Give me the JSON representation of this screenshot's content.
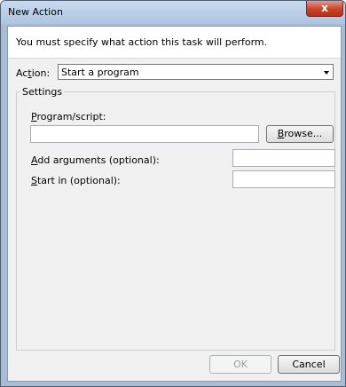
{
  "window": {
    "title": "New Action",
    "close_label": "x"
  },
  "header": {
    "text": "You must specify what action this task will perform."
  },
  "action": {
    "label_pre": "Ac",
    "label_key": "t",
    "label_post": "ion:",
    "selected": "Start a program"
  },
  "settings": {
    "title": "Settings",
    "program": {
      "label_key": "P",
      "label_rest": "rogram/script:",
      "value": "",
      "browse_key": "B",
      "browse_rest": "rowse..."
    },
    "arguments": {
      "label_key": "A",
      "label_rest": "dd arguments (optional):",
      "value": ""
    },
    "start_in": {
      "label_key": "S",
      "label_rest": "tart in (optional):",
      "value": ""
    }
  },
  "buttons": {
    "ok": "OK",
    "cancel": "Cancel"
  },
  "colors": {
    "title_bar": "#c8daee",
    "close_button": "#c9432a",
    "dialog_bg": "#f0f0f0",
    "disabled_text": "#9a9a9a"
  },
  "icons": {
    "close": "close-icon",
    "dropdown": "chevron-down-icon"
  }
}
